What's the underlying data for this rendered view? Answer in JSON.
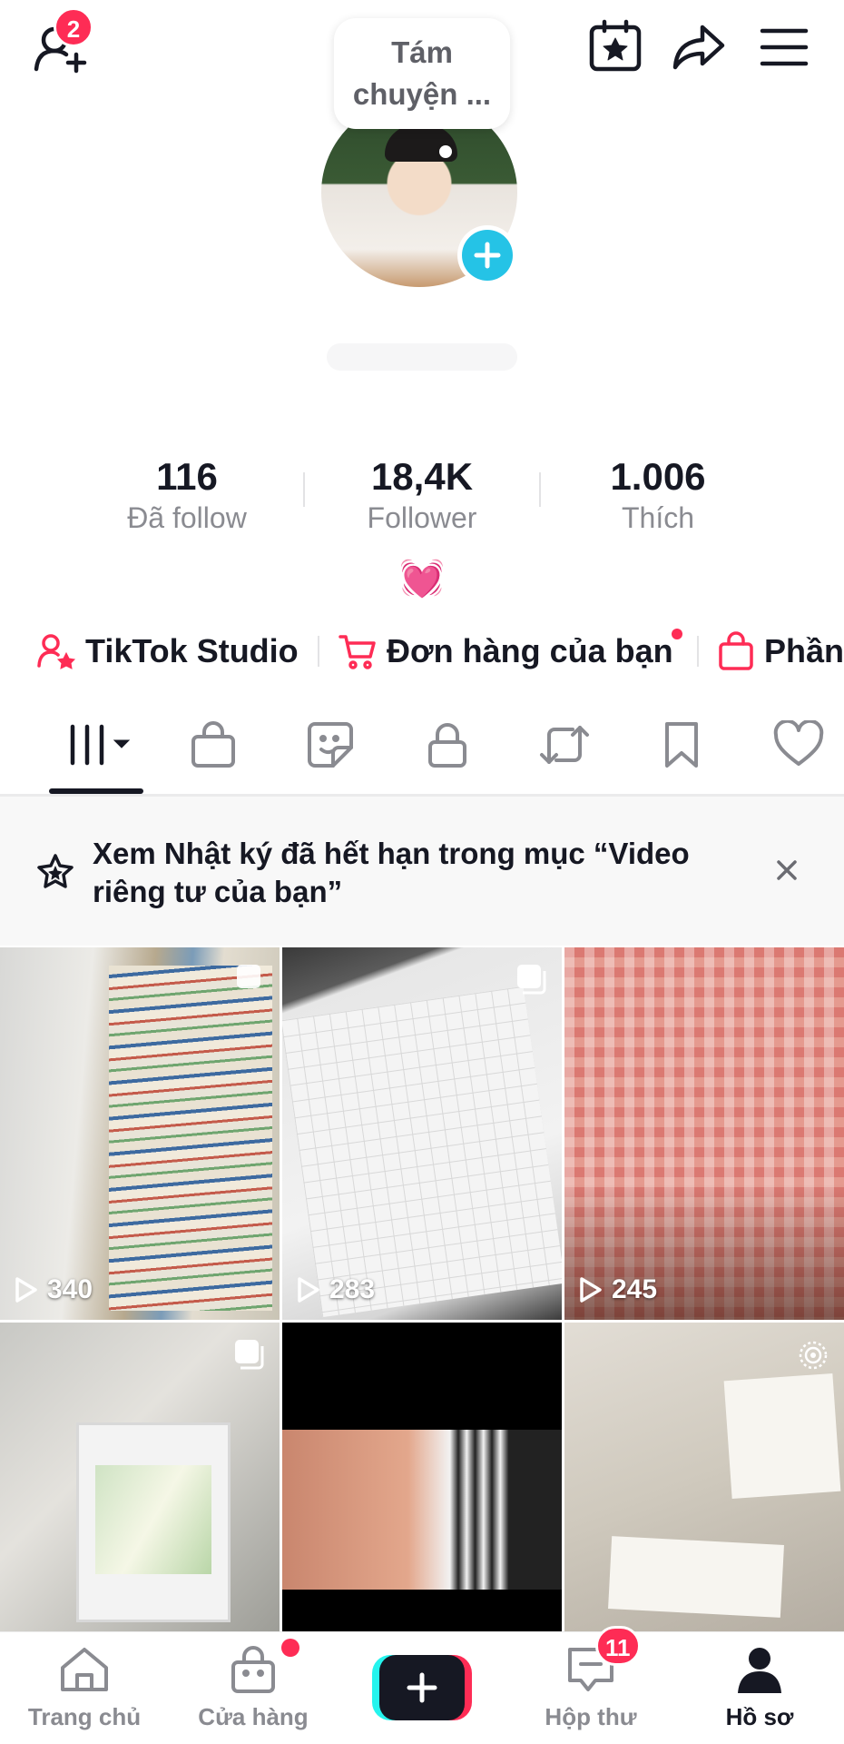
{
  "header": {
    "add_friend_badge": "2",
    "note_bubble": "Tám chuyện ..."
  },
  "stats": [
    {
      "value": "116",
      "label": "Đã follow"
    },
    {
      "value": "18,4K",
      "label": "Follower"
    },
    {
      "value": "1.006",
      "label": "Thích"
    }
  ],
  "bio_emoji": "💓",
  "shortcuts": {
    "studio": "TikTok Studio",
    "orders": "Đơn hàng của bạn",
    "third": "Phần"
  },
  "banner": {
    "text": "Xem Nhật ký đã hết hạn trong mục “Video riêng tư của bạn”"
  },
  "videos": [
    {
      "views": "340"
    },
    {
      "views": "283"
    },
    {
      "views": "245"
    }
  ],
  "bottom_nav": {
    "home": "Trang chủ",
    "shop": "Cửa hàng",
    "inbox": "Hộp thư",
    "inbox_badge": "11",
    "profile": "Hồ sơ"
  },
  "colors": {
    "accent": "#fe2c55",
    "cyan": "#25c3e6"
  }
}
